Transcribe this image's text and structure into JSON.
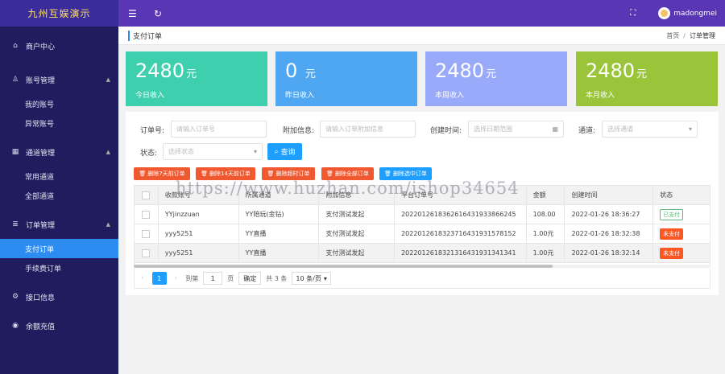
{
  "sidebar": {
    "logo": "九州互娱演示",
    "items": [
      {
        "label": "商户中心",
        "icon": "home-icon",
        "glyph": "⌂"
      },
      {
        "label": "账号管理",
        "icon": "user-icon",
        "glyph": "♙",
        "arrow": "▲",
        "children": [
          {
            "label": "我的账号"
          },
          {
            "label": "异常账号"
          }
        ]
      },
      {
        "label": "通道管理",
        "icon": "channel-icon",
        "glyph": "▦",
        "arrow": "▲",
        "children": [
          {
            "label": "常用通道"
          },
          {
            "label": "全部通道"
          }
        ]
      },
      {
        "label": "订单管理",
        "icon": "order-icon",
        "glyph": "≣",
        "arrow": "▲",
        "children": [
          {
            "label": "支付订单",
            "active": true
          },
          {
            "label": "手续费订单"
          }
        ]
      },
      {
        "label": "接口信息",
        "icon": "gear-icon",
        "glyph": "⚙"
      },
      {
        "label": "余额充值",
        "icon": "wallet-icon",
        "glyph": "◉"
      }
    ]
  },
  "topbar": {
    "menu_icon": "☰",
    "refresh_icon": "↻",
    "fullscreen_icon": "⛶",
    "username": "madongmei"
  },
  "breadcrumb": {
    "title": "支付订单",
    "home": "首页",
    "separator": "/",
    "current": "订单管理"
  },
  "stats": [
    {
      "value": "2480",
      "unit": "元",
      "label": "今日收入",
      "color": "#3ecfae"
    },
    {
      "value": "0",
      "unit": "元",
      "label": "昨日收入",
      "color": "#4ea7f0"
    },
    {
      "value": "2480",
      "unit": "元",
      "label": "本周收入",
      "color": "#9aaafa"
    },
    {
      "value": "2480",
      "unit": "元",
      "label": "本月收入",
      "color": "#9ac53b"
    }
  ],
  "filters": {
    "order_no_label": "订单号:",
    "order_no_placeholder": "请输入订单号",
    "extra_label": "附加信息:",
    "extra_placeholder": "请输入订单附加信息",
    "time_label": "创建时间:",
    "time_placeholder": "选择日期范围",
    "channel_label": "通道:",
    "channel_placeholder": "选择通道",
    "status_label": "状态:",
    "status_placeholder": "选择状态",
    "search_button": "查询"
  },
  "actions": [
    {
      "label": "删除7天前订单",
      "color": "#f0582f"
    },
    {
      "label": "删除14天前订单",
      "color": "#f0582f"
    },
    {
      "label": "删除超时订单",
      "color": "#f0582f"
    },
    {
      "label": "删除全部订单",
      "color": "#f0582f"
    },
    {
      "label": "删除选中订单",
      "color": "#1e9fff"
    }
  ],
  "table": {
    "headers": [
      "收款账号",
      "所属通道",
      "附加信息",
      "平台订单号",
      "金额",
      "创建时间",
      "状态"
    ],
    "rows": [
      {
        "account": "YYjinzzuan",
        "channel": "YY陪玩(金钻)",
        "extra": "支付测试发起",
        "order_no": "2022012618362616431933866245",
        "amount": "108.00",
        "time": "2022-01-26 18:36:27",
        "status": "已支付",
        "paid": true
      },
      {
        "account": "yyy5251",
        "channel": "YY直播",
        "extra": "支付测试发起",
        "order_no": "2022012618323716431931578152",
        "amount": "1.00元",
        "time": "2022-01-26 18:32:38",
        "status": "未支付",
        "paid": false
      },
      {
        "account": "yyy5251",
        "channel": "YY直播",
        "extra": "支付测试发起",
        "order_no": "2022012618321316431931341341",
        "amount": "1.00元",
        "time": "2022-01-26 18:32:14",
        "status": "未支付",
        "paid": false
      }
    ]
  },
  "pager": {
    "prev": "‹",
    "current": "1",
    "next": "›",
    "goto_label": "到第",
    "goto_value": "1",
    "page_unit": "页",
    "confirm": "确定",
    "total": "共 3 条",
    "page_size": "10 条/页",
    "page_size_arrow": "▾"
  },
  "watermark": "https://www.huzhan.com/ishop34654"
}
